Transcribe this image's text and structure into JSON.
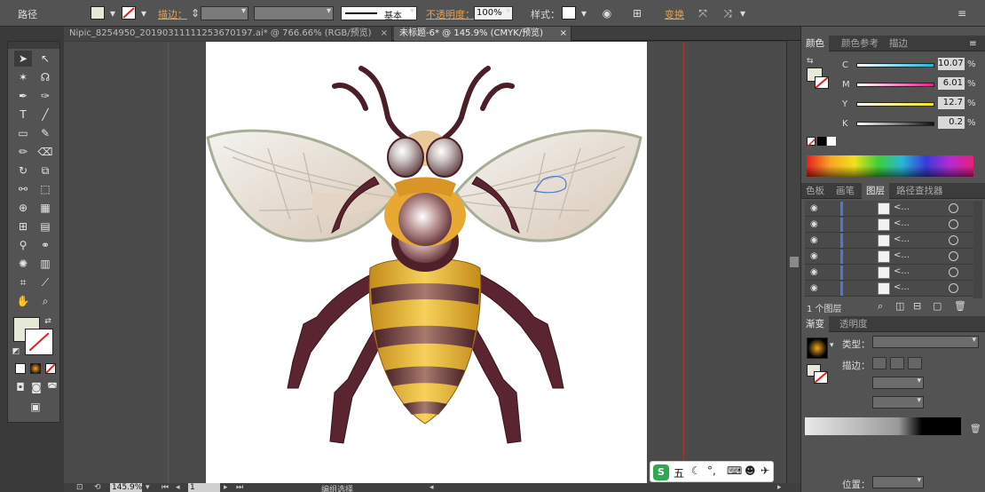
{
  "control_bar": {
    "selection_label": "路径",
    "stroke_label": "描边：",
    "stroke_profile": "基本",
    "opacity_label": "不透明度：",
    "opacity_value": "100%",
    "style_label": "样式：",
    "transform_label": "变换"
  },
  "tabs": [
    {
      "label": "Nipic_8254950_20190311111253670197.ai* @ 766.66% (RGB/预览)",
      "close": "×"
    },
    {
      "label": "未标题-6* @ 145.9% (CMYK/预览)",
      "close": "×"
    }
  ],
  "color_panel": {
    "tabs": [
      "颜色",
      "颜色参考",
      "描边"
    ],
    "sliders": [
      {
        "channel": "C",
        "value": "10.07",
        "color": "#1fb7d9"
      },
      {
        "channel": "M",
        "value": "6.01",
        "color": "#e0218a"
      },
      {
        "channel": "Y",
        "value": "12.7",
        "color": "#f3e31a"
      },
      {
        "channel": "K",
        "value": "0.2",
        "color": "#111111"
      }
    ],
    "unit": "%"
  },
  "layers_panel": {
    "tabs": [
      "色板",
      "画笔",
      "图层",
      "路径查找器"
    ],
    "rows": [
      "<...",
      "<...",
      "<...",
      "<...",
      "<...",
      "<..."
    ],
    "footer": "1 个图层"
  },
  "gradient_panel": {
    "tabs": [
      "渐变",
      "透明度"
    ],
    "type_label": "类型：",
    "stroke_label": "描边：",
    "position_label": "位置："
  },
  "status_bar": {
    "zoom": "145.9%",
    "page": "1",
    "tool_status": "编组选择"
  },
  "ime_bar": {
    "label": "五"
  },
  "colors": {
    "app_bg": "#535353",
    "canvas_bg": "#4b4b4b",
    "accent_orange": "#e8a050",
    "guide_red": "#c43030"
  }
}
